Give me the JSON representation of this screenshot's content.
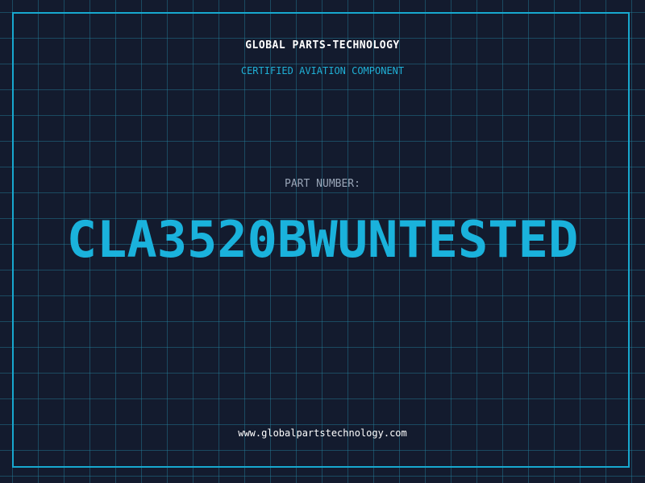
{
  "header": {
    "company": "GLOBAL PARTS-TECHNOLOGY",
    "subtitle": "CERTIFIED AVIATION COMPONENT"
  },
  "part": {
    "label": "PART NUMBER:",
    "number": "CLA3520BWUNTESTED"
  },
  "footer": {
    "website": "www.globalpartstechnology.com"
  },
  "colors": {
    "background": "#131b2e",
    "grid": "#2682a0",
    "accent": "#1ab2dc",
    "frame": "#17a8cf",
    "label": "#9aa6b8",
    "text": "#ffffff"
  }
}
